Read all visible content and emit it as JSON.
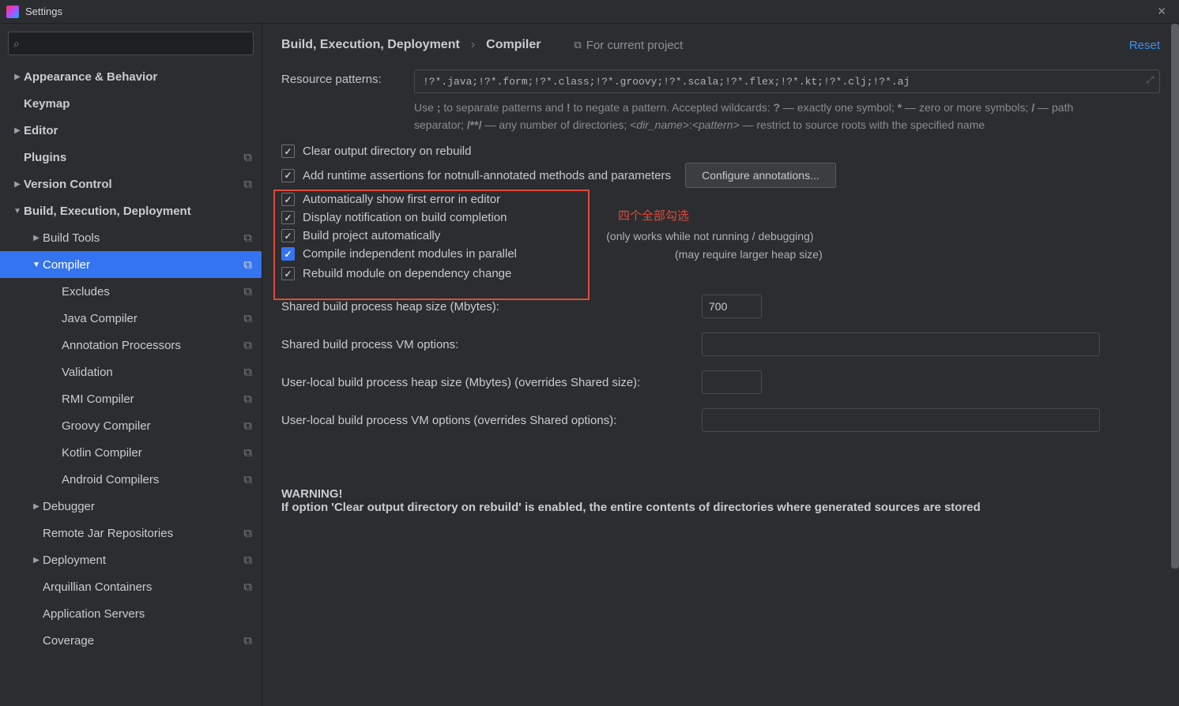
{
  "window": {
    "title": "Settings"
  },
  "header": {
    "reset": "Reset",
    "for_project": "For current project",
    "breadcrumb": [
      "Build, Execution, Deployment",
      "Compiler"
    ]
  },
  "sidebar": {
    "items": [
      {
        "label": "Appearance & Behavior",
        "depth": 0,
        "chev": "right",
        "bold": true,
        "proj": false
      },
      {
        "label": "Keymap",
        "depth": 0,
        "chev": "none",
        "bold": true,
        "proj": false
      },
      {
        "label": "Editor",
        "depth": 0,
        "chev": "right",
        "bold": true,
        "proj": false
      },
      {
        "label": "Plugins",
        "depth": 0,
        "chev": "none",
        "bold": true,
        "proj": true
      },
      {
        "label": "Version Control",
        "depth": 0,
        "chev": "right",
        "bold": true,
        "proj": true
      },
      {
        "label": "Build, Execution, Deployment",
        "depth": 0,
        "chev": "down",
        "bold": true,
        "proj": false
      },
      {
        "label": "Build Tools",
        "depth": 1,
        "chev": "right",
        "bold": false,
        "proj": true
      },
      {
        "label": "Compiler",
        "depth": 1,
        "chev": "down",
        "bold": false,
        "proj": true,
        "selected": true
      },
      {
        "label": "Excludes",
        "depth": 2,
        "chev": "none",
        "bold": false,
        "proj": true
      },
      {
        "label": "Java Compiler",
        "depth": 2,
        "chev": "none",
        "bold": false,
        "proj": true
      },
      {
        "label": "Annotation Processors",
        "depth": 2,
        "chev": "none",
        "bold": false,
        "proj": true
      },
      {
        "label": "Validation",
        "depth": 2,
        "chev": "none",
        "bold": false,
        "proj": true
      },
      {
        "label": "RMI Compiler",
        "depth": 2,
        "chev": "none",
        "bold": false,
        "proj": true
      },
      {
        "label": "Groovy Compiler",
        "depth": 2,
        "chev": "none",
        "bold": false,
        "proj": true
      },
      {
        "label": "Kotlin Compiler",
        "depth": 2,
        "chev": "none",
        "bold": false,
        "proj": true
      },
      {
        "label": "Android Compilers",
        "depth": 2,
        "chev": "none",
        "bold": false,
        "proj": true
      },
      {
        "label": "Debugger",
        "depth": 1,
        "chev": "right",
        "bold": false,
        "proj": false
      },
      {
        "label": "Remote Jar Repositories",
        "depth": 1,
        "chev": "none",
        "bold": false,
        "proj": true
      },
      {
        "label": "Deployment",
        "depth": 1,
        "chev": "right",
        "bold": false,
        "proj": true
      },
      {
        "label": "Arquillian Containers",
        "depth": 1,
        "chev": "none",
        "bold": false,
        "proj": true
      },
      {
        "label": "Application Servers",
        "depth": 1,
        "chev": "none",
        "bold": false,
        "proj": false
      },
      {
        "label": "Coverage",
        "depth": 1,
        "chev": "none",
        "bold": false,
        "proj": true
      }
    ]
  },
  "form": {
    "resource_patterns_label": "Resource patterns:",
    "resource_patterns_value": "!?*.java;!?*.form;!?*.class;!?*.groovy;!?*.scala;!?*.flex;!?*.kt;!?*.clj;!?*.aj",
    "help_line": "Use ; to separate patterns and ! to negate a pattern. Accepted wildcards: ? — exactly one symbol; * — zero or more symbols; / — path separator; /**/ — any number of directories; <dir_name>:<pattern> — restrict to source roots with the specified name",
    "clear_output": {
      "label": "Clear output directory on rebuild",
      "checked": true
    },
    "add_runtime": {
      "label": "Add runtime assertions for notnull-annotated methods and parameters",
      "checked": true
    },
    "configure_btn": "Configure annotations...",
    "auto_show_err": {
      "label": "Automatically show first error in editor",
      "checked": true
    },
    "display_notif": {
      "label": "Display notification on build completion",
      "checked": true
    },
    "build_auto": {
      "label": "Build project automatically",
      "checked": true,
      "note": "(only works while not running / debugging)"
    },
    "compile_parallel": {
      "label": "Compile independent modules in parallel",
      "checked": true,
      "note": "(may require larger heap size)"
    },
    "rebuild_dep": {
      "label": "Rebuild module on dependency change",
      "checked": true
    },
    "shared_heap_label": "Shared build process heap size (Mbytes):",
    "shared_heap_value": "700",
    "shared_vm_label": "Shared build process VM options:",
    "shared_vm_value": "",
    "user_heap_label": "User-local build process heap size (Mbytes) (overrides Shared size):",
    "user_heap_value": "",
    "user_vm_label": "User-local build process VM options (overrides Shared options):",
    "user_vm_value": "",
    "warning_head": "WARNING!",
    "warning_body": "If option 'Clear output directory on rebuild' is enabled, the entire contents of directories where generated sources are stored"
  },
  "annotation": {
    "text": "四个全部勾选"
  }
}
